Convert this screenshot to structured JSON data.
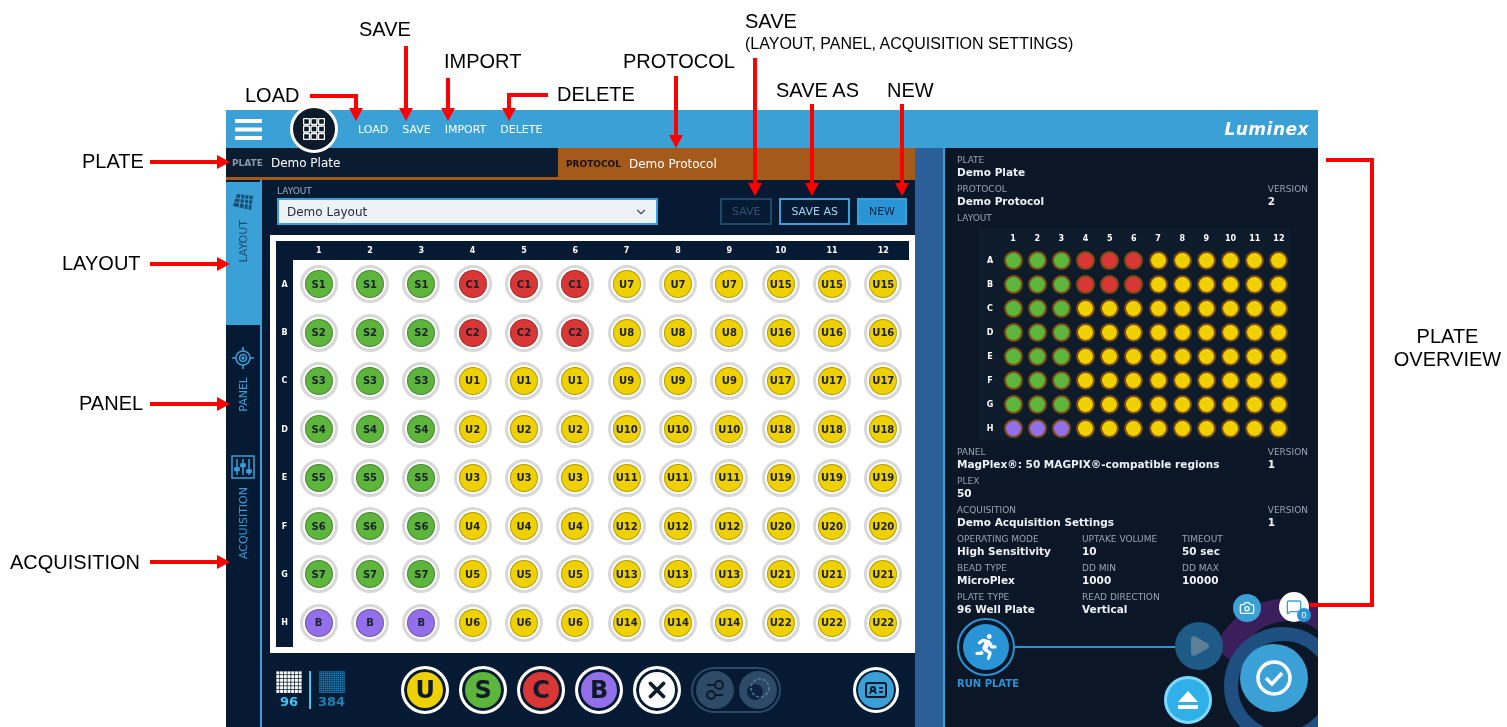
{
  "top_bar": {
    "menu": [
      {
        "label": "LOAD"
      },
      {
        "label": "SAVE"
      },
      {
        "label": "IMPORT"
      },
      {
        "label": "DELETE"
      }
    ],
    "logo": "Luminex"
  },
  "header": {
    "plate_label": "PLATE",
    "plate": "Demo Plate",
    "protocol_label": "PROTOCOL",
    "protocol": "Demo Protocol"
  },
  "sidebar": {
    "tabs": [
      {
        "label": "LAYOUT",
        "kind": "layout",
        "selected": true
      },
      {
        "label": "PANEL",
        "kind": "panel",
        "selected": false
      },
      {
        "label": "ACQUISITION",
        "kind": "acquisition",
        "selected": false
      }
    ]
  },
  "layout": {
    "label": "LAYOUT",
    "value": "Demo Layout",
    "buttons": [
      {
        "label": "SAVE",
        "kind": "outline",
        "disabled": true
      },
      {
        "label": "SAVE AS",
        "kind": "outline",
        "disabled": false
      },
      {
        "label": "NEW",
        "kind": "filled",
        "disabled": false
      }
    ]
  },
  "plate": {
    "columns": [
      "1",
      "2",
      "3",
      "4",
      "5",
      "6",
      "7",
      "8",
      "9",
      "10",
      "11",
      "12"
    ],
    "rows": [
      {
        "letter": "A",
        "wells": [
          {
            "label": "S1",
            "kind": "standard"
          },
          {
            "label": "S1",
            "kind": "standard"
          },
          {
            "label": "S1",
            "kind": "standard"
          },
          {
            "label": "C1",
            "kind": "control"
          },
          {
            "label": "C1",
            "kind": "control"
          },
          {
            "label": "C1",
            "kind": "control"
          },
          {
            "label": "U7",
            "kind": "unknown"
          },
          {
            "label": "U7",
            "kind": "unknown"
          },
          {
            "label": "U7",
            "kind": "unknown"
          },
          {
            "label": "U15",
            "kind": "unknown"
          },
          {
            "label": "U15",
            "kind": "unknown"
          },
          {
            "label": "U15",
            "kind": "unknown"
          }
        ]
      },
      {
        "letter": "B",
        "wells": [
          {
            "label": "S2",
            "kind": "standard"
          },
          {
            "label": "S2",
            "kind": "standard"
          },
          {
            "label": "S2",
            "kind": "standard"
          },
          {
            "label": "C2",
            "kind": "control"
          },
          {
            "label": "C2",
            "kind": "control"
          },
          {
            "label": "C2",
            "kind": "control"
          },
          {
            "label": "U8",
            "kind": "unknown"
          },
          {
            "label": "U8",
            "kind": "unknown"
          },
          {
            "label": "U8",
            "kind": "unknown"
          },
          {
            "label": "U16",
            "kind": "unknown"
          },
          {
            "label": "U16",
            "kind": "unknown"
          },
          {
            "label": "U16",
            "kind": "unknown"
          }
        ]
      },
      {
        "letter": "C",
        "wells": [
          {
            "label": "S3",
            "kind": "standard"
          },
          {
            "label": "S3",
            "kind": "standard"
          },
          {
            "label": "S3",
            "kind": "standard"
          },
          {
            "label": "U1",
            "kind": "unknown"
          },
          {
            "label": "U1",
            "kind": "unknown"
          },
          {
            "label": "U1",
            "kind": "unknown"
          },
          {
            "label": "U9",
            "kind": "unknown"
          },
          {
            "label": "U9",
            "kind": "unknown"
          },
          {
            "label": "U9",
            "kind": "unknown"
          },
          {
            "label": "U17",
            "kind": "unknown"
          },
          {
            "label": "U17",
            "kind": "unknown"
          },
          {
            "label": "U17",
            "kind": "unknown"
          }
        ]
      },
      {
        "letter": "D",
        "wells": [
          {
            "label": "S4",
            "kind": "standard"
          },
          {
            "label": "S4",
            "kind": "standard"
          },
          {
            "label": "S4",
            "kind": "standard"
          },
          {
            "label": "U2",
            "kind": "unknown"
          },
          {
            "label": "U2",
            "kind": "unknown"
          },
          {
            "label": "U2",
            "kind": "unknown"
          },
          {
            "label": "U10",
            "kind": "unknown"
          },
          {
            "label": "U10",
            "kind": "unknown"
          },
          {
            "label": "U10",
            "kind": "unknown"
          },
          {
            "label": "U18",
            "kind": "unknown"
          },
          {
            "label": "U18",
            "kind": "unknown"
          },
          {
            "label": "U18",
            "kind": "unknown"
          }
        ]
      },
      {
        "letter": "E",
        "wells": [
          {
            "label": "S5",
            "kind": "standard"
          },
          {
            "label": "S5",
            "kind": "standard"
          },
          {
            "label": "S5",
            "kind": "standard"
          },
          {
            "label": "U3",
            "kind": "unknown"
          },
          {
            "label": "U3",
            "kind": "unknown"
          },
          {
            "label": "U3",
            "kind": "unknown"
          },
          {
            "label": "U11",
            "kind": "unknown"
          },
          {
            "label": "U11",
            "kind": "unknown"
          },
          {
            "label": "U11",
            "kind": "unknown"
          },
          {
            "label": "U19",
            "kind": "unknown"
          },
          {
            "label": "U19",
            "kind": "unknown"
          },
          {
            "label": "U19",
            "kind": "unknown"
          }
        ]
      },
      {
        "letter": "F",
        "wells": [
          {
            "label": "S6",
            "kind": "standard"
          },
          {
            "label": "S6",
            "kind": "standard"
          },
          {
            "label": "S6",
            "kind": "standard"
          },
          {
            "label": "U4",
            "kind": "unknown"
          },
          {
            "label": "U4",
            "kind": "unknown"
          },
          {
            "label": "U4",
            "kind": "unknown"
          },
          {
            "label": "U12",
            "kind": "unknown"
          },
          {
            "label": "U12",
            "kind": "unknown"
          },
          {
            "label": "U12",
            "kind": "unknown"
          },
          {
            "label": "U20",
            "kind": "unknown"
          },
          {
            "label": "U20",
            "kind": "unknown"
          },
          {
            "label": "U20",
            "kind": "unknown"
          }
        ]
      },
      {
        "letter": "G",
        "wells": [
          {
            "label": "S7",
            "kind": "standard"
          },
          {
            "label": "S7",
            "kind": "standard"
          },
          {
            "label": "S7",
            "kind": "standard"
          },
          {
            "label": "U5",
            "kind": "unknown"
          },
          {
            "label": "U5",
            "kind": "unknown"
          },
          {
            "label": "U5",
            "kind": "unknown"
          },
          {
            "label": "U13",
            "kind": "unknown"
          },
          {
            "label": "U13",
            "kind": "unknown"
          },
          {
            "label": "U13",
            "kind": "unknown"
          },
          {
            "label": "U21",
            "kind": "unknown"
          },
          {
            "label": "U21",
            "kind": "unknown"
          },
          {
            "label": "U21",
            "kind": "unknown"
          }
        ]
      },
      {
        "letter": "H",
        "wells": [
          {
            "label": "B",
            "kind": "blank"
          },
          {
            "label": "B",
            "kind": "blank"
          },
          {
            "label": "B",
            "kind": "blank"
          },
          {
            "label": "U6",
            "kind": "unknown"
          },
          {
            "label": "U6",
            "kind": "unknown"
          },
          {
            "label": "U6",
            "kind": "unknown"
          },
          {
            "label": "U14",
            "kind": "unknown"
          },
          {
            "label": "U14",
            "kind": "unknown"
          },
          {
            "label": "U14",
            "kind": "unknown"
          },
          {
            "label": "U22",
            "kind": "unknown"
          },
          {
            "label": "U22",
            "kind": "unknown"
          },
          {
            "label": "U22",
            "kind": "unknown"
          }
        ]
      }
    ]
  },
  "toolbar": {
    "formats": [
      {
        "label": "96",
        "selected": true
      },
      {
        "label": "384",
        "selected": false
      }
    ],
    "well_types": [
      {
        "label": "U",
        "kind": "unknown"
      },
      {
        "label": "S",
        "kind": "standard"
      },
      {
        "label": "C",
        "kind": "control"
      },
      {
        "label": "B",
        "kind": "blank"
      }
    ]
  },
  "overview": {
    "plate": {
      "label": "PLATE",
      "value": "Demo Plate"
    },
    "protocol": {
      "label": "PROTOCOL",
      "value": "Demo Protocol",
      "version_label": "VERSION",
      "version": "2"
    },
    "layout_label": "LAYOUT",
    "columns": [
      "1",
      "2",
      "3",
      "4",
      "5",
      "6",
      "7",
      "8",
      "9",
      "10",
      "11",
      "12"
    ],
    "row_letters": [
      "A",
      "B",
      "C",
      "D",
      "E",
      "F",
      "G",
      "H"
    ],
    "panel": {
      "label": "PANEL",
      "value": "MagPlex®: 50 MAGPIX®-compatible regions",
      "version_label": "VERSION",
      "version": "1"
    },
    "plex": {
      "label": "PLEX",
      "value": "50"
    },
    "acquisition": {
      "label": "ACQUISITION",
      "value": "Demo Acquisition Settings",
      "version_label": "VERSION",
      "version": "1"
    },
    "settings": [
      {
        "label": "OPERATING MODE",
        "value": "High Sensitivity"
      },
      {
        "label": "UPTAKE VOLUME",
        "value": "10"
      },
      {
        "label": "TIMEOUT",
        "value": "50 sec"
      },
      {
        "label": "BEAD TYPE",
        "value": "MicroPlex"
      },
      {
        "label": "DD MIN",
        "value": "1000"
      },
      {
        "label": "DD MAX",
        "value": "10000"
      },
      {
        "label": "PLATE TYPE",
        "value": "96 Well Plate"
      },
      {
        "label": "READ DIRECTION",
        "value": "Vertical"
      }
    ]
  },
  "run": {
    "label": "RUN PLATE",
    "messages": "0"
  },
  "annotations": [
    {
      "text": "LOAD"
    },
    {
      "text": "SAVE"
    },
    {
      "text": "IMPORT"
    },
    {
      "text": "DELETE"
    },
    {
      "text": "PROTOCOL"
    },
    {
      "text": "SAVE",
      "note": "(LAYOUT, PANEL, ACQUISITION SETTINGS)"
    },
    {
      "text": "SAVE AS"
    },
    {
      "text": "NEW"
    },
    {
      "text": "PLATE"
    },
    {
      "text": "LAYOUT"
    },
    {
      "text": "PANEL"
    },
    {
      "text": "ACQUISITION"
    },
    {
      "text": "PLATE OVERVIEW"
    }
  ]
}
